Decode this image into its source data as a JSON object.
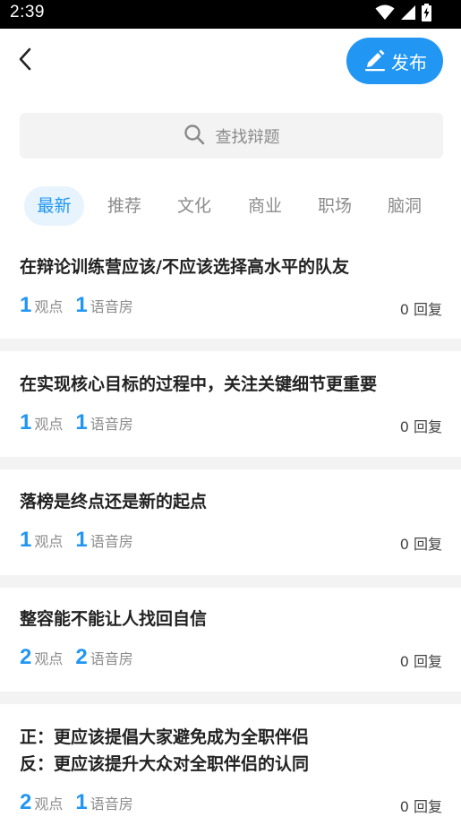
{
  "status_bar": {
    "time": "2:39",
    "icons": [
      "wifi-icon",
      "signal-icon",
      "battery-charging-icon"
    ]
  },
  "header": {
    "back_icon": "chevron-left-icon",
    "publish_label": "发布",
    "publish_icon": "pencil-icon"
  },
  "search": {
    "placeholder": "查找辩题"
  },
  "tabs": [
    {
      "label": "最新",
      "active": true
    },
    {
      "label": "推荐",
      "active": false
    },
    {
      "label": "文化",
      "active": false
    },
    {
      "label": "商业",
      "active": false
    },
    {
      "label": "职场",
      "active": false
    },
    {
      "label": "脑洞",
      "active": false
    }
  ],
  "topics": [
    {
      "title_lines": [
        "在辩论训练营应该/不应该选择高水平的队友"
      ],
      "viewpoints": "1",
      "viewpoints_label": "观点",
      "rooms": "1",
      "rooms_label": "语音房",
      "replies": "0",
      "replies_label": "回复"
    },
    {
      "title_lines": [
        "在实现核心目标的过程中，关注关键细节更重要"
      ],
      "viewpoints": "1",
      "viewpoints_label": "观点",
      "rooms": "1",
      "rooms_label": "语音房",
      "replies": "0",
      "replies_label": "回复"
    },
    {
      "title_lines": [
        "落榜是终点还是新的起点"
      ],
      "viewpoints": "1",
      "viewpoints_label": "观点",
      "rooms": "1",
      "rooms_label": "语音房",
      "replies": "0",
      "replies_label": "回复"
    },
    {
      "title_lines": [
        "整容能不能让人找回自信"
      ],
      "viewpoints": "2",
      "viewpoints_label": "观点",
      "rooms": "2",
      "rooms_label": "语音房",
      "replies": "0",
      "replies_label": "回复"
    },
    {
      "title_lines": [
        "正：更应该提倡大家避免成为全职伴侣",
        "反：更应该提升大众对全职伴侣的认同"
      ],
      "viewpoints": "2",
      "viewpoints_label": "观点",
      "rooms": "1",
      "rooms_label": "语音房",
      "replies": "0",
      "replies_label": "回复"
    }
  ],
  "colors": {
    "accent": "#2196f3",
    "tab_active_bg": "#e8f4fd",
    "divider": "#f3f3f3",
    "muted_text": "#8c8c8c"
  }
}
